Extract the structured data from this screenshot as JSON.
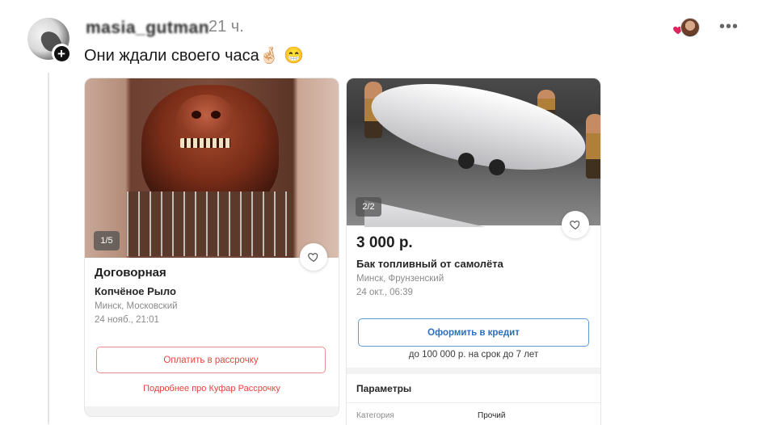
{
  "post": {
    "username": "masia_gutman",
    "time": "21 ч.",
    "text": "Они ждали своего часа🤞🏻 😁"
  },
  "icons": {
    "avatar_plus": "+",
    "more": "•••",
    "like": "heart-icon",
    "card_heart": "heart-outline-icon"
  },
  "colors": {
    "like_red": "#e0245e",
    "accent_red": "#e4443f",
    "accent_blue": "#2a6fbe"
  },
  "listings": [
    {
      "photo_counter": "1/5",
      "price": "Договорная",
      "title": "Копчёное Рыло",
      "location": "Минск, Московский",
      "date": "24 нояб., 21:01",
      "action_button": "Оплатить в рассрочку",
      "action_link": "Подробнее про Куфар Рассрочку"
    },
    {
      "photo_counter": "2/2",
      "price": "3 000 р.",
      "title": "Бак топливный от самолёта",
      "location": "Минск, Фрунзенский",
      "date": "24 окт., 06:39",
      "action_button": "Оформить в кредит",
      "credit_note": "до 100 000 р. на срок до 7 лет",
      "params_heading": "Параметры",
      "params_cut_label": "Категория",
      "params_cut_value": "Прочий"
    }
  ]
}
